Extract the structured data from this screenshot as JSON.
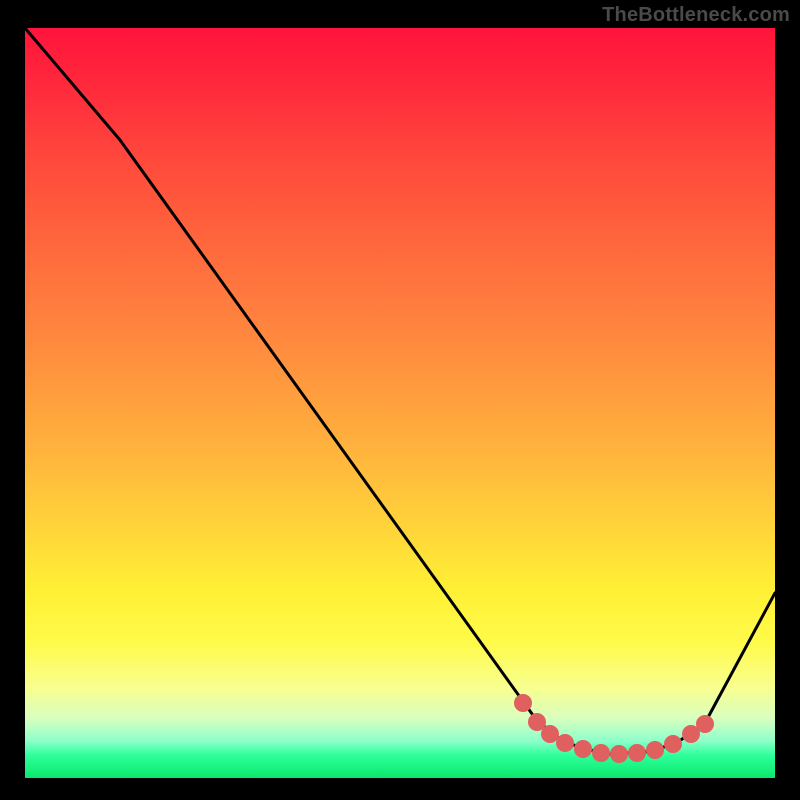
{
  "watermark": "TheBottleneck.com",
  "chart_data": {
    "type": "line",
    "title": "",
    "xlabel": "",
    "ylabel": "",
    "xlim": [
      0,
      100
    ],
    "ylim": [
      0,
      100
    ],
    "background": "vertical-gradient red→orange→yellow→green (top=high bottleneck, bottom=low)",
    "series": [
      {
        "name": "bottleneck-curve",
        "x": [
          0,
          12,
          68,
          71,
          74,
          78,
          83,
          87,
          91,
          100
        ],
        "y": [
          100,
          85,
          8,
          6,
          4,
          3.2,
          3.5,
          5,
          7,
          25
        ]
      }
    ],
    "highlighted_range": {
      "name": "optimal-zone",
      "x": [
        66,
        68,
        70,
        72,
        74,
        77,
        79,
        82,
        84,
        86,
        89,
        91
      ],
      "y": [
        10,
        7.5,
        6,
        4.8,
        4,
        3.3,
        3.2,
        3.3,
        3.7,
        4.5,
        5.9,
        7.2
      ],
      "color": "#e06060"
    },
    "grid": false,
    "legend": false
  }
}
